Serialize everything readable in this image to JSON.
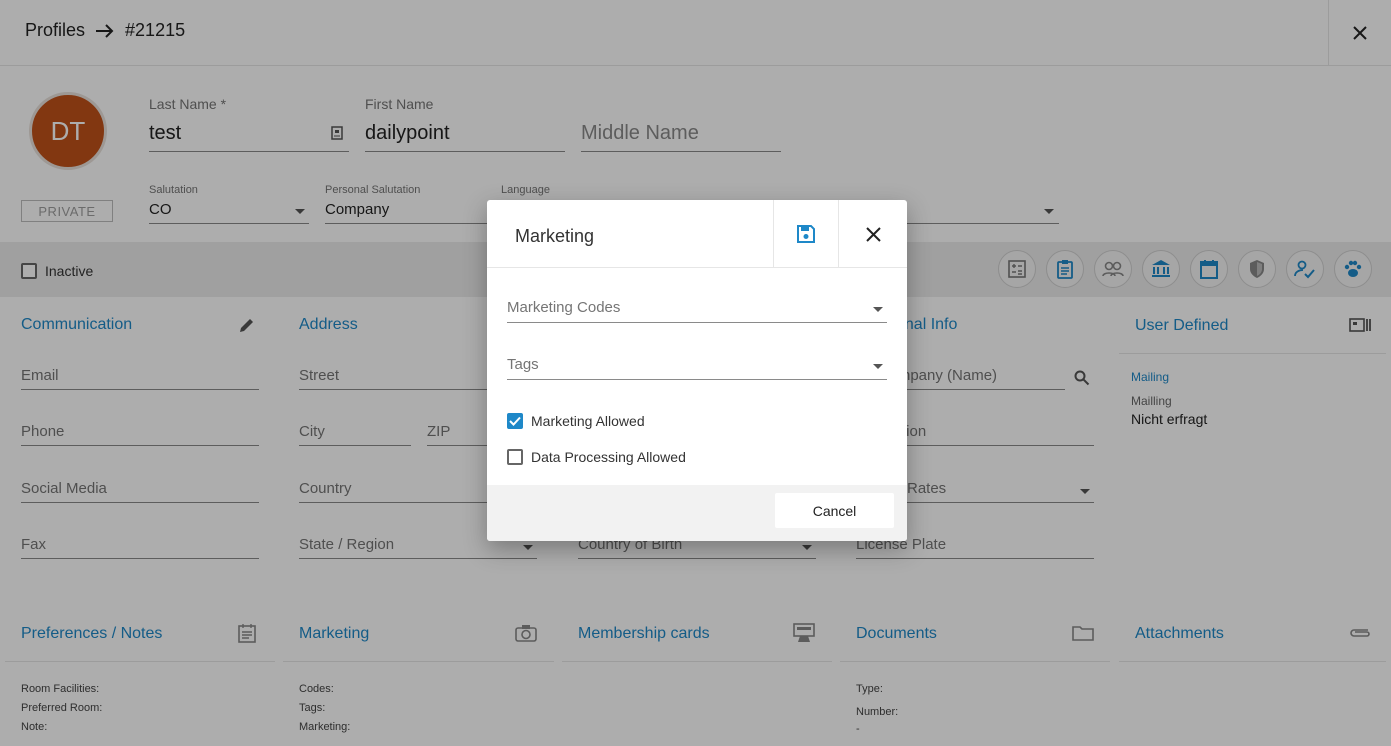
{
  "header": {
    "breadcrumb_root": "Profiles",
    "breadcrumb_id": "#21215"
  },
  "profile": {
    "avatar_initials": "DT",
    "last_name_label": "Last Name *",
    "last_name": "test",
    "first_name_label": "First Name",
    "first_name": "dailypoint",
    "middle_name_placeholder": "Middle Name",
    "private_label": "PRIVATE",
    "salutation_label": "Salutation",
    "salutation": "CO",
    "personal_salutation_label": "Personal Salutation",
    "personal_salutation": "Company",
    "language_label": "Language"
  },
  "toolbar": {
    "inactive_label": "Inactive",
    "icons": [
      "calculator-icon",
      "clipboard-icon",
      "people-icon",
      "bank-icon",
      "calendar-icon",
      "shield-icon",
      "user-check-icon",
      "paw-icon"
    ]
  },
  "communication": {
    "title": "Communication",
    "email": "Email",
    "phone": "Phone",
    "social": "Social Media",
    "fax": "Fax"
  },
  "address": {
    "title": "Address",
    "street": "Street",
    "city": "City",
    "zip": "ZIP",
    "country": "Country",
    "state": "State / Region"
  },
  "personal": {
    "title_partial": "onal Info",
    "company_partial": "npany (Name)",
    "position_partial": "tion",
    "rates_partial": "Rates",
    "country_birth": "Country of Birth",
    "license": "License Plate"
  },
  "user_defined": {
    "title": "User Defined",
    "mailing_link": "Mailing",
    "mailing_label": "Mailling",
    "mailing_value": "Nicht erfragt"
  },
  "bottom_cards": {
    "preferences": {
      "title": "Preferences / Notes",
      "room_facilities": "Room Facilities:",
      "preferred_room": "Preferred Room:",
      "note": "Note:"
    },
    "marketing": {
      "title": "Marketing",
      "codes": "Codes:",
      "tags": "Tags:",
      "marketing": "Marketing:"
    },
    "membership": {
      "title": "Membership cards"
    },
    "documents": {
      "title": "Documents",
      "type": "Type:",
      "number": "Number:",
      "number_value": "-"
    },
    "attachments": {
      "title": "Attachments"
    }
  },
  "dialog": {
    "title": "Marketing",
    "marketing_codes_placeholder": "Marketing Codes",
    "tags_placeholder": "Tags",
    "marketing_allowed_label": "Marketing Allowed",
    "marketing_allowed": true,
    "data_processing_label": "Data Processing Allowed",
    "data_processing_allowed": false,
    "cancel_label": "Cancel"
  },
  "colors": {
    "accent": "#1e88c8",
    "avatar": "#c0521a",
    "overlay": "rgba(0,0,0,0.32)"
  }
}
